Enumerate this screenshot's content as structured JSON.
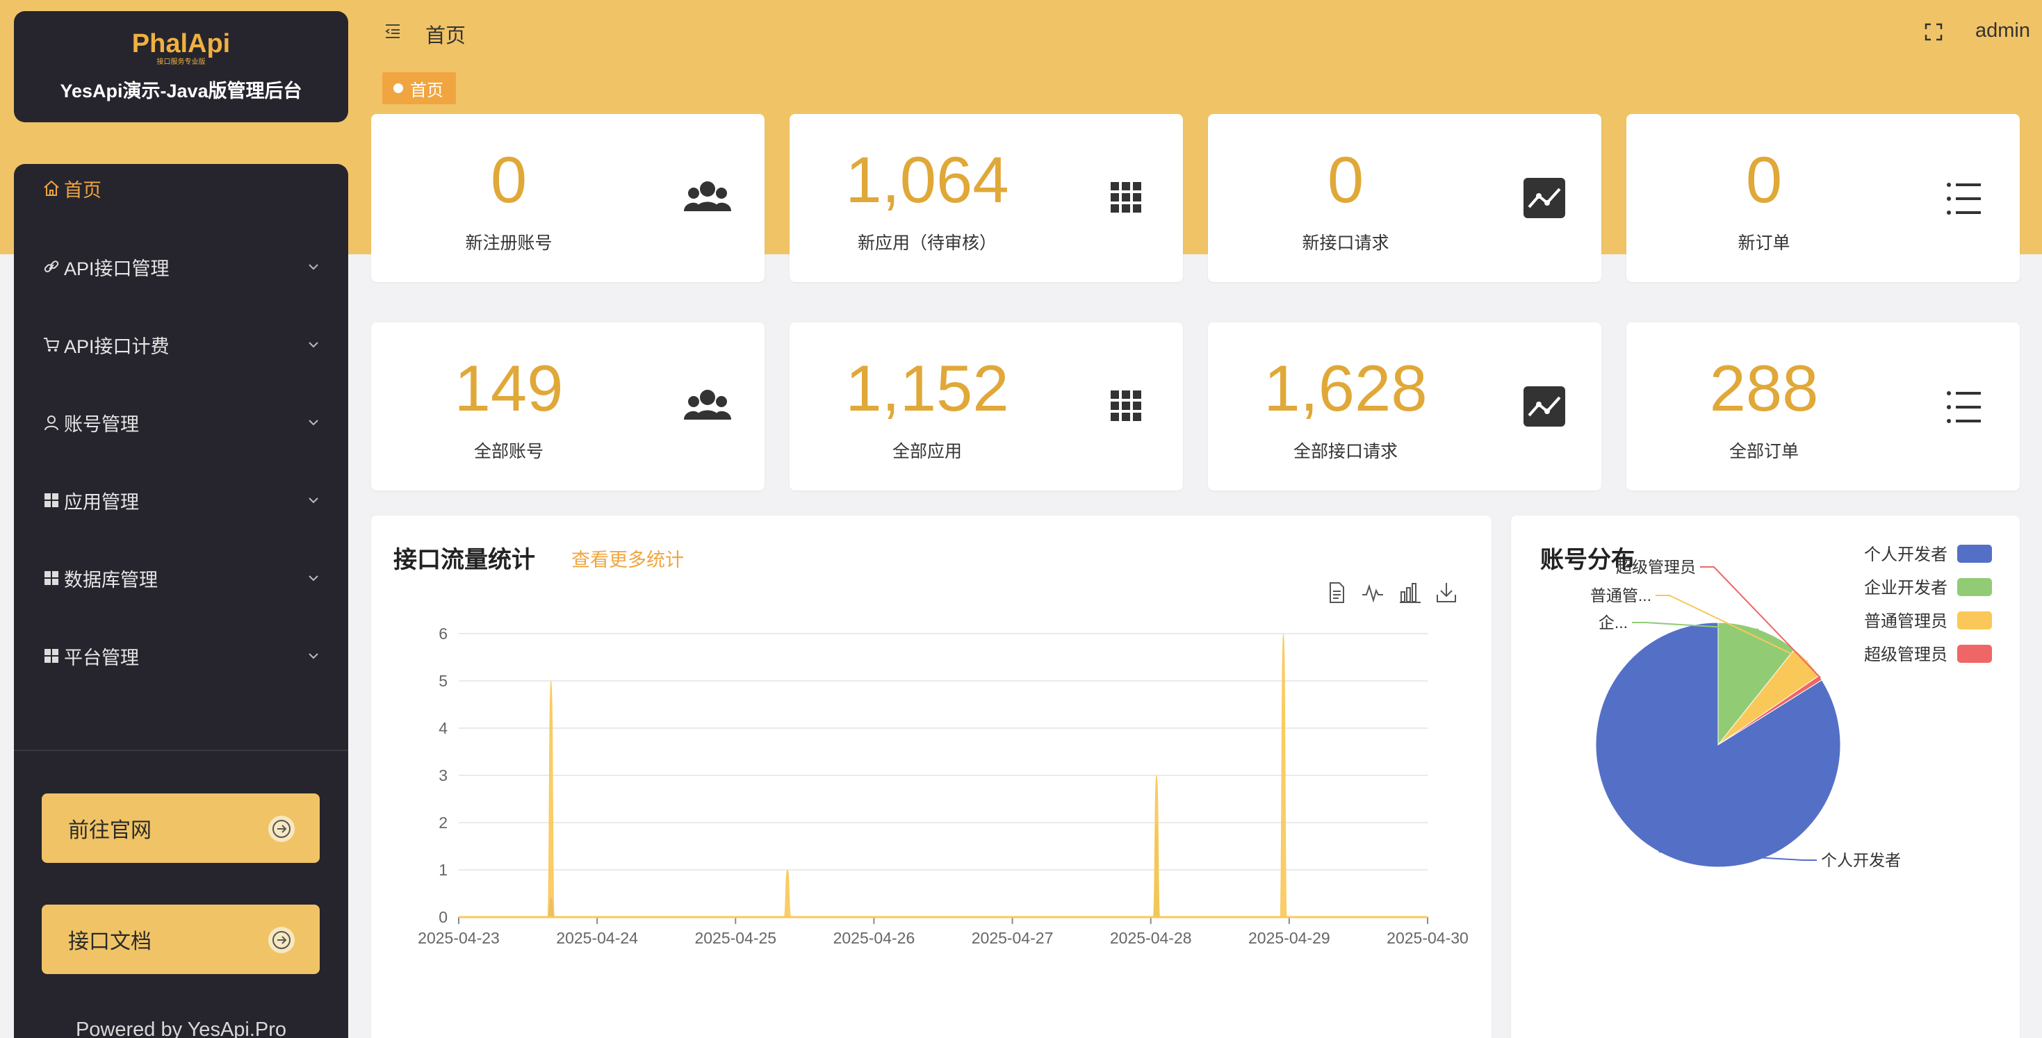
{
  "brand": {
    "logo_text": "PhalApi",
    "logo_sub": "接口服务专业版",
    "title": "YesApi演示-Java版管理后台"
  },
  "sidebar": {
    "items": [
      {
        "label": "首页",
        "icon": "home-icon",
        "active": true
      },
      {
        "label": "API接口管理",
        "icon": "link-icon"
      },
      {
        "label": "API接口计费",
        "icon": "cart-icon"
      },
      {
        "label": "账号管理",
        "icon": "user-icon"
      },
      {
        "label": "应用管理",
        "icon": "grid-icon"
      },
      {
        "label": "数据库管理",
        "icon": "grid-icon"
      },
      {
        "label": "平台管理",
        "icon": "grid-icon"
      }
    ],
    "buttons": [
      {
        "label": "前往官网"
      },
      {
        "label": "接口文档"
      }
    ],
    "powered": "Powered by YesApi.Pro"
  },
  "header": {
    "breadcrumb": "首页",
    "user": "admin",
    "tab": "首页"
  },
  "stats": [
    {
      "value": "0",
      "label": "新注册账号",
      "icon": "users-icon"
    },
    {
      "value": "1,064",
      "label": "新应用（待审核）",
      "icon": "apps-icon"
    },
    {
      "value": "0",
      "label": "新接口请求",
      "icon": "line-chart-icon"
    },
    {
      "value": "0",
      "label": "新订单",
      "icon": "list-icon"
    },
    {
      "value": "149",
      "label": "全部账号",
      "icon": "users-icon"
    },
    {
      "value": "1,152",
      "label": "全部应用",
      "icon": "apps-icon"
    },
    {
      "value": "1,628",
      "label": "全部接口请求",
      "icon": "line-chart-icon"
    },
    {
      "value": "288",
      "label": "全部订单",
      "icon": "list-icon"
    }
  ],
  "traffic": {
    "title": "接口流量统计",
    "more": "查看更多统计"
  },
  "accounts": {
    "title": "账号分布"
  },
  "colors": {
    "accent": "#f0a540",
    "band": "#f0c466",
    "number": "#e0a838",
    "sidebar": "#26252e"
  },
  "chart_data": [
    {
      "type": "area",
      "title": "",
      "x": [
        "2025-04-23",
        "2025-04-24",
        "2025-04-25",
        "2025-04-26",
        "2025-04-27",
        "2025-04-28",
        "2025-04-29",
        "2025-04-30"
      ],
      "ylim": [
        0,
        6
      ],
      "yticks": [
        0,
        1,
        2,
        3,
        4,
        5,
        6
      ],
      "grid": true,
      "series": [
        {
          "color": "#5470c6",
          "points": [
            [
              "2025-04-23T16:00",
              0.4
            ],
            [
              "2025-04-28T01:00",
              0.7
            ]
          ]
        },
        {
          "color": "#91cc75",
          "points": [
            [
              "2025-04-28T01:00",
              2
            ]
          ]
        },
        {
          "color": "#fac858",
          "points": [
            [
              "2025-04-23T16:00",
              5
            ],
            [
              "2025-04-25T09:00",
              1
            ],
            [
              "2025-04-28T01:00",
              3
            ],
            [
              "2025-04-28T23:00",
              6
            ]
          ]
        }
      ]
    },
    {
      "type": "pie",
      "title": "账号分布",
      "legend_position": "top-right",
      "slices": [
        {
          "label": "个人开发者",
          "short": "个人开发者",
          "value": 125,
          "color": "#5470c6"
        },
        {
          "label": "企业开发者",
          "short": "企...",
          "value": 16,
          "color": "#91cc75"
        },
        {
          "label": "普通管理员",
          "short": "普通管...",
          "value": 7,
          "color": "#fac858"
        },
        {
          "label": "超级管理员",
          "short": "超级管理员",
          "value": 1,
          "color": "#ee6666"
        }
      ]
    }
  ]
}
